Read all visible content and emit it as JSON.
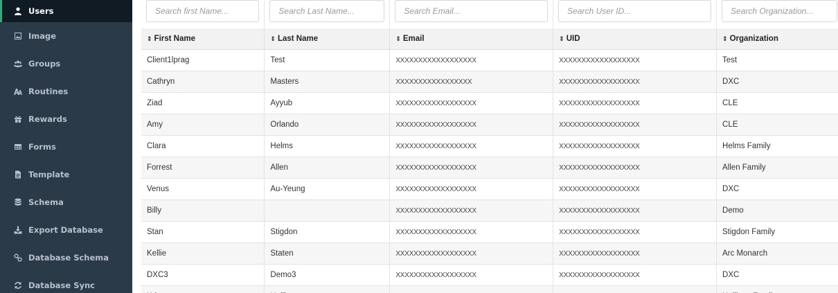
{
  "sidebar": {
    "items": [
      {
        "label": "Users",
        "icon": "user-icon",
        "active": true
      },
      {
        "label": "Image",
        "icon": "image-icon"
      },
      {
        "label": "Groups",
        "icon": "groups-icon"
      },
      {
        "label": "Routines",
        "icon": "routines-icon"
      },
      {
        "label": "Rewards",
        "icon": "gift-icon"
      },
      {
        "label": "Forms",
        "icon": "table-icon"
      },
      {
        "label": "Template",
        "icon": "file-icon"
      },
      {
        "label": "Schema",
        "icon": "database-icon"
      },
      {
        "label": "Export Database",
        "icon": "download-icon"
      },
      {
        "label": "Database Schema",
        "icon": "link-icon"
      },
      {
        "label": "Database Sync",
        "icon": "sync-icon"
      }
    ]
  },
  "search": {
    "first_name_placeholder": "Search first Name...",
    "last_name_placeholder": "Search Last Name...",
    "email_placeholder": "Search Email...",
    "uid_placeholder": "Search User ID...",
    "organization_placeholder": "Search Organization..."
  },
  "table": {
    "sort_glyph": "⇕",
    "columns": [
      "First Name",
      "Last Name",
      "Email",
      "UID",
      "Organization"
    ],
    "rows": [
      [
        "Client1lprag",
        "Test",
        "XXXXXXXXXXXXXXXXXX",
        "XXXXXXXXXXXXXXXXXX",
        "Test"
      ],
      [
        "Cathryn",
        "Masters",
        "XXXXXXXXXXXXXXXXX",
        "XXXXXXXXXXXXXXXXXX",
        "DXC"
      ],
      [
        "Ziad",
        "Ayyub",
        "XXXXXXXXXXXXXXXXXX",
        "XXXXXXXXXXXXXXXXXX",
        "CLE"
      ],
      [
        "Amy",
        "Orlando",
        "XXXXXXXXXXXXXXXXXX",
        "XXXXXXXXXXXXXXXXXX",
        "CLE"
      ],
      [
        "Clara",
        "Helms",
        "XXXXXXXXXXXXXXXXXX",
        "XXXXXXXXXXXXXXXXXX",
        "Helms Family"
      ],
      [
        "Forrest",
        "Allen",
        "XXXXXXXXXXXXXXXXXX",
        "XXXXXXXXXXXXXXXXXX",
        "Allen Family"
      ],
      [
        "Venus",
        "Au-Yeung",
        "XXXXXXXXXXXXXXXXXX",
        "XXXXXXXXXXXXXXXXXX",
        "DXC"
      ],
      [
        "Billy",
        "",
        "XXXXXXXXXXXXXXXXXX",
        "XXXXXXXXXXXXXXXXXX",
        "Demo"
      ],
      [
        "Stan",
        "Stigdon",
        "XXXXXXXXXXXXXXXXXX",
        "XXXXXXXXXXXXXXXXXX",
        "Stigdon Family"
      ],
      [
        "Kellie",
        "Staten",
        "XXXXXXXXXXXXXXXXXX",
        "XXXXXXXXXXXXXXXXXX",
        "Arc Monarch"
      ],
      [
        "DXC3",
        "Demo3",
        "XXXXXXXXXXXXXXXXXX",
        "XXXXXXXXXXXXXXXXXX",
        "DXC"
      ],
      [
        "Kristy",
        "Hullings",
        "XXXXXXXXXXXXXXXXXX",
        "XXXXXXXXXXXXXXXXXX",
        "Hullings Family"
      ]
    ]
  },
  "colors": {
    "sidebar_bg": "#2b3a48",
    "sidebar_active_bg": "#111b24",
    "active_accent": "#3aa776"
  }
}
